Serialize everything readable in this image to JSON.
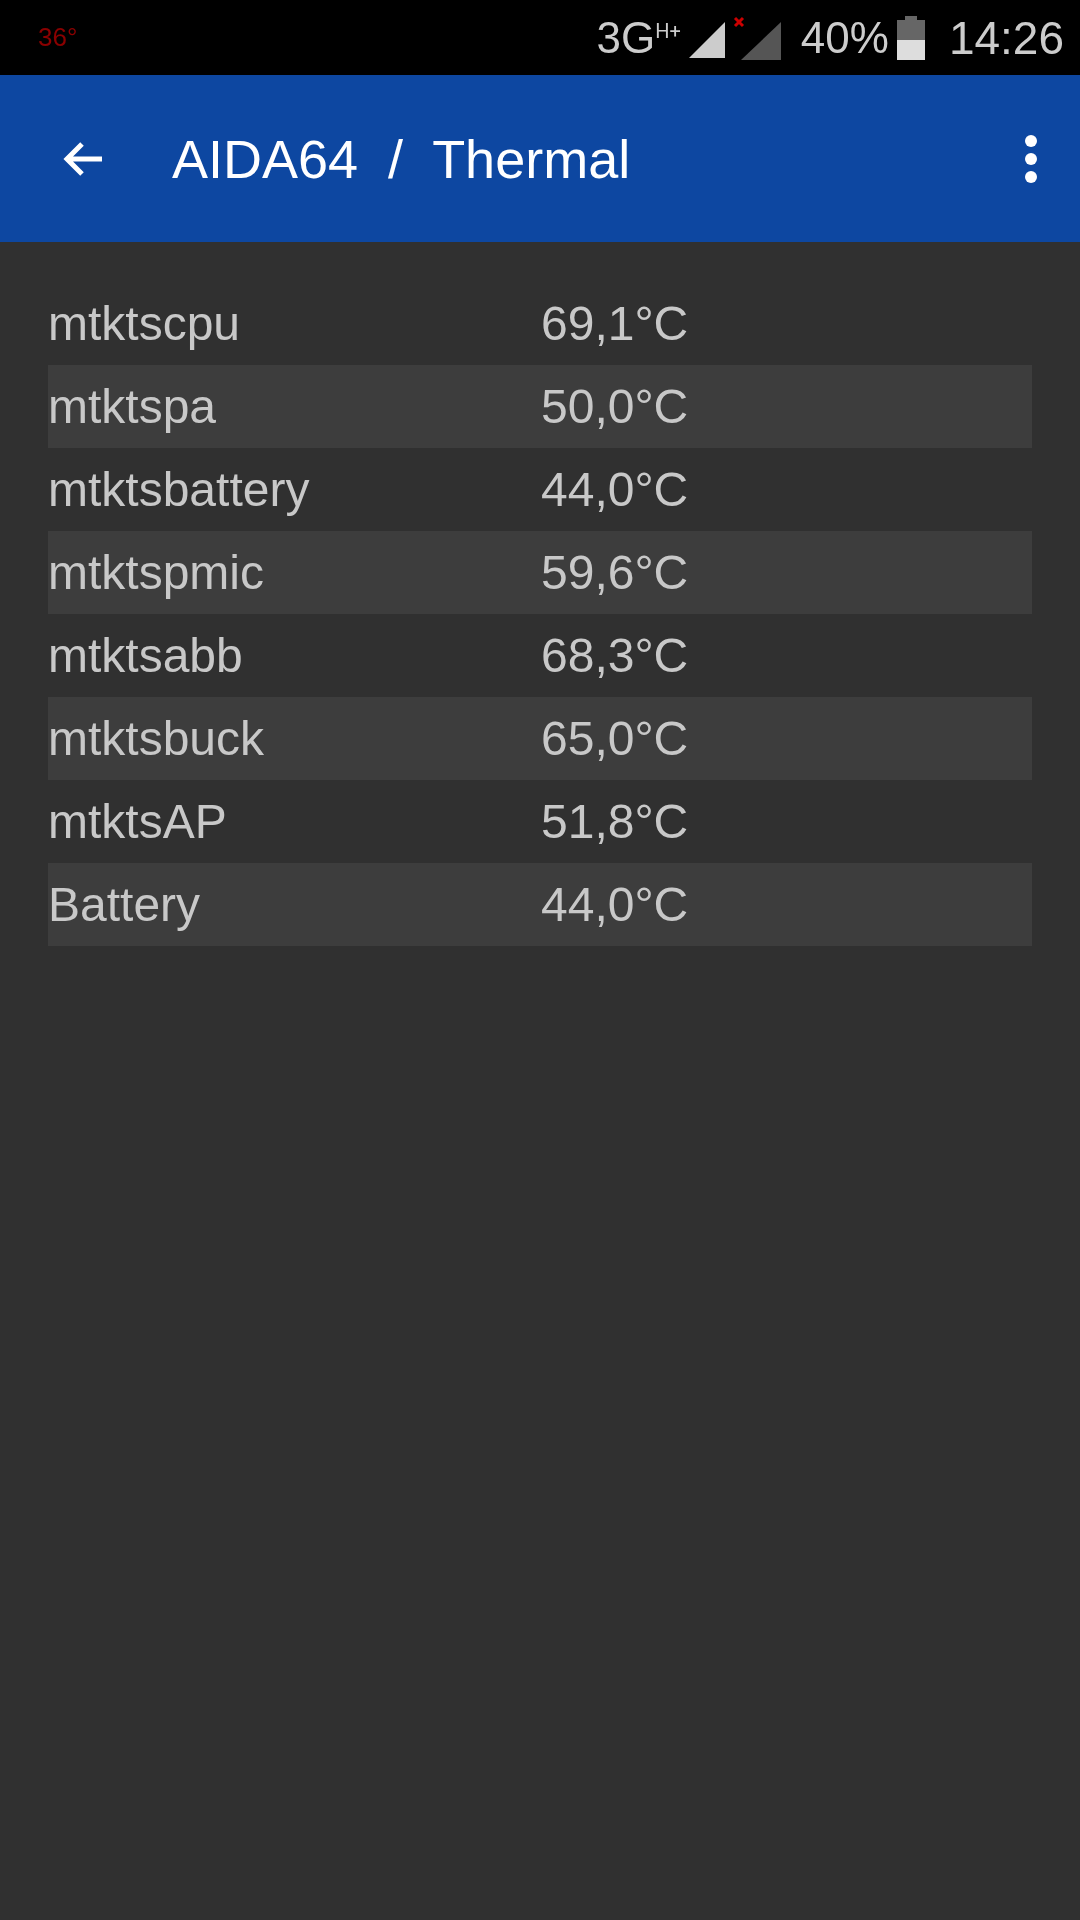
{
  "status_bar": {
    "temperature": "36°",
    "network": "3G",
    "network_sub": "H+",
    "battery": "40%",
    "time": "14:26"
  },
  "app_bar": {
    "title": "AIDA64  /  Thermal"
  },
  "sensors": [
    {
      "name": "mtktscpu",
      "value": "69,1°C"
    },
    {
      "name": "mtktspa",
      "value": "50,0°C"
    },
    {
      "name": "mtktsbattery",
      "value": "44,0°C"
    },
    {
      "name": "mtktspmic",
      "value": "59,6°C"
    },
    {
      "name": "mtktsabb",
      "value": "68,3°C"
    },
    {
      "name": "mtktsbuck",
      "value": "65,0°C"
    },
    {
      "name": "mtktsAP",
      "value": "51,8°C"
    },
    {
      "name": "Battery",
      "value": "44,0°C"
    }
  ]
}
